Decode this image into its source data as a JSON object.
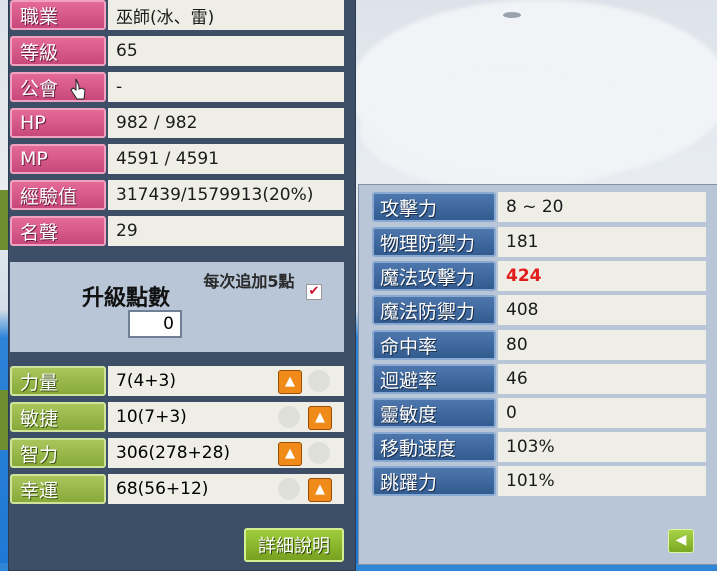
{
  "colors": {
    "pink_label": "#d8578a",
    "green_label": "#98b84a",
    "blue_label": "#3f6aa0",
    "highlight_red": "#e21b1b",
    "upgrade_button": "#f08a18"
  },
  "profile": [
    {
      "label": "職業",
      "value": "巫師(冰、雷)"
    },
    {
      "label": "等級",
      "value": "65"
    },
    {
      "label": "公會",
      "value": "-"
    },
    {
      "label": "HP",
      "value": "982 / 982"
    },
    {
      "label": "MP",
      "value": "4591 / 4591"
    },
    {
      "label": "經驗值",
      "value": "317439/1579913(20%)"
    },
    {
      "label": "名聲",
      "value": "29"
    }
  ],
  "upgrade": {
    "label": "升級點數",
    "points": "0",
    "per_five_label": "每次追加5點",
    "per_five_checked": true
  },
  "attributes": [
    {
      "label": "力量",
      "value": "7(4+3)"
    },
    {
      "label": "敏捷",
      "value": "10(7+3)"
    },
    {
      "label": "智力",
      "value": "306(278+28)"
    },
    {
      "label": "幸運",
      "value": "68(56+12)"
    }
  ],
  "detail_button": "詳細說明",
  "combat_stats": [
    {
      "label": "攻擊力",
      "value": "8 ~ 20"
    },
    {
      "label": "物理防禦力",
      "value": "181"
    },
    {
      "label": "魔法攻擊力",
      "value": "424",
      "highlight": true
    },
    {
      "label": "魔法防禦力",
      "value": "408"
    },
    {
      "label": "命中率",
      "value": "80"
    },
    {
      "label": "迴避率",
      "value": "46"
    },
    {
      "label": "靈敏度",
      "value": "0"
    },
    {
      "label": "移動速度",
      "value": "103%"
    },
    {
      "label": "跳躍力",
      "value": "101%"
    }
  ],
  "icons": {
    "upgrade": "arrow-up-icon",
    "back": "arrow-left-icon",
    "cursor": "hand-cursor-icon",
    "check": "checkmark-icon"
  }
}
